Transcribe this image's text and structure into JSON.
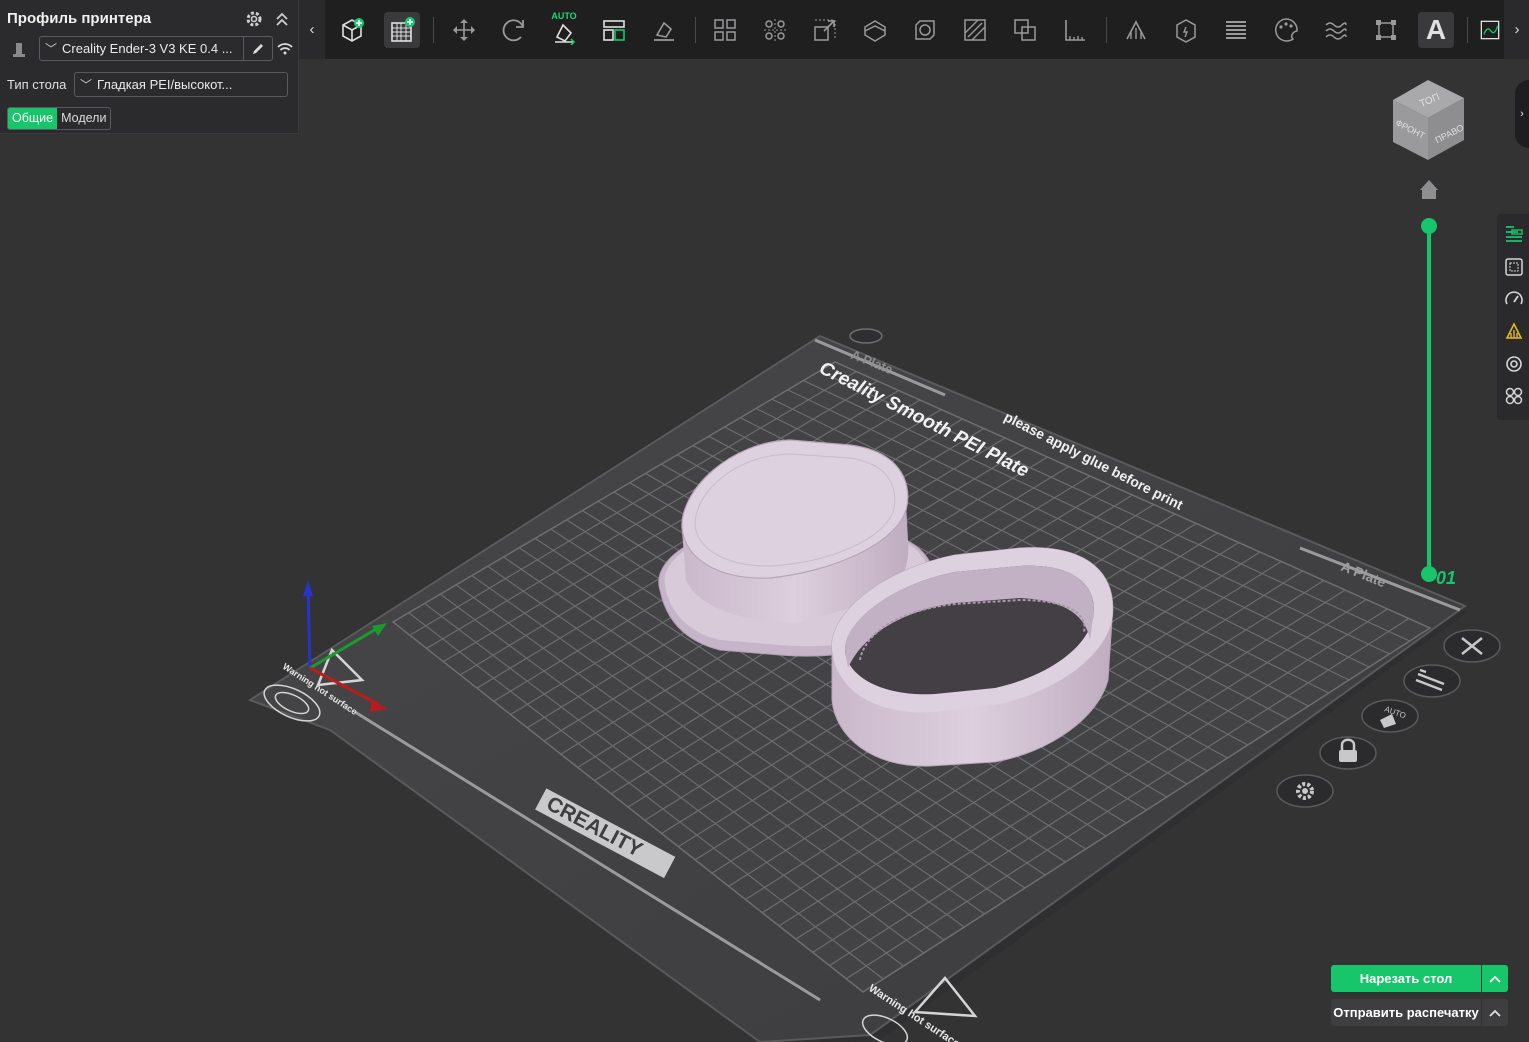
{
  "printer_panel": {
    "title": "Профиль принтера",
    "printer_name": "Creality Ender-3 V3 KE 0.4 ...",
    "bed_label": "Тип стола",
    "bed_type": "Гладкая PEI/высокот...",
    "tabs": [
      "Общие",
      "Модели"
    ],
    "active_tab": "Общие"
  },
  "toolbar": {
    "collapse_left": "‹",
    "expand_right": "›",
    "auto_orient_badge": "AUTO",
    "text_tool_glyph": "A",
    "icons": [
      "add-object-icon",
      "add-plate-icon",
      "move-icon",
      "rotate-icon",
      "auto-orient-icon",
      "arrange-icon",
      "lay-on-face-icon",
      "split-objects-icon",
      "split-parts-icon",
      "scale-icon",
      "cut-icon",
      "hollow-icon",
      "variable-layer-icon",
      "boolean-icon",
      "measure-icon",
      "support-paint-icon",
      "seam-paint-icon",
      "layer-height-icon",
      "color-paint-icon",
      "fuzzy-skin-icon",
      "mesh-boolean-icon",
      "text-icon",
      "svg-icon"
    ]
  },
  "viewport": {
    "plate_title": "Creality Smooth PEI Plate",
    "plate_note": "please apply glue before print",
    "plate_tag": "A Plate",
    "brand": "CREALITY",
    "warning": "Warning hot surface",
    "layer_top_label": "01",
    "view_cube": {
      "top": "ТОП",
      "front": "ФРОНТ",
      "right": "ПРАВО"
    },
    "model_color": "#d9c8d9",
    "accent": "#17c56a"
  },
  "plate_buttons": [
    "close-plate-icon",
    "arrange-plate-icon",
    "auto-orient-plate-icon",
    "lock-plate-icon",
    "plate-settings-icon"
  ],
  "plate_auto_badge": "AUTO",
  "right_tools": [
    "layers-icon",
    "bed-shape-icon",
    "speed-icon",
    "support-icon",
    "inspect-icon",
    "assembly-icon"
  ],
  "actions": {
    "slice": "Нарезать стол",
    "send": "Отправить распечатку"
  }
}
